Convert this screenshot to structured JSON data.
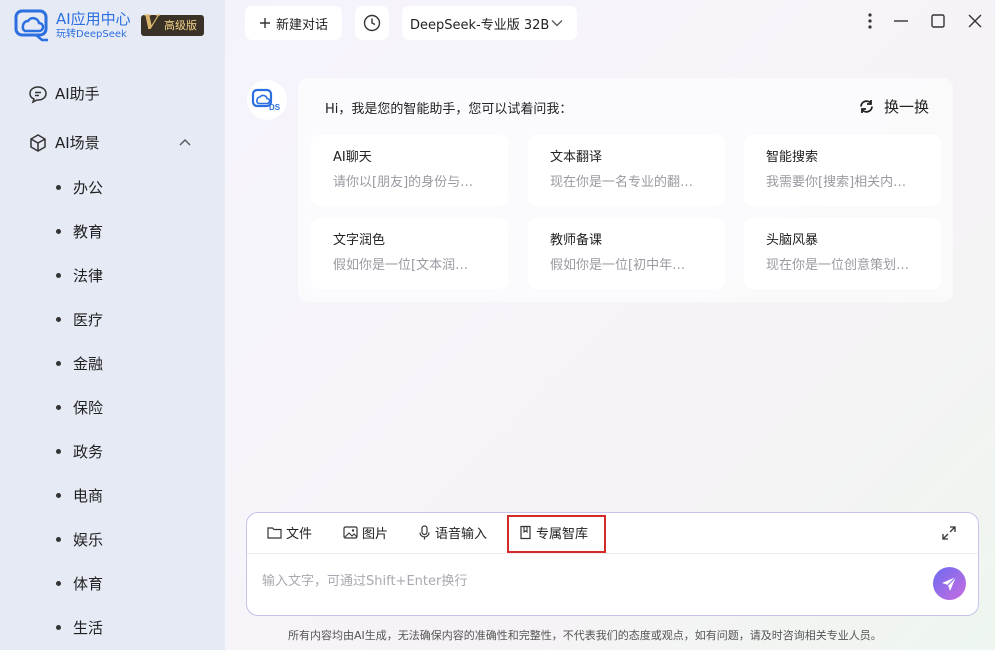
{
  "brand": {
    "title": "AI应用中心",
    "subtitle": "玩转DeepSeek",
    "badge_letter": "V",
    "badge_text": "高级版",
    "accent": "#2b6fe0"
  },
  "sidebar": {
    "items": [
      {
        "label": "AI助手",
        "icon": "chat-bubble-icon"
      },
      {
        "label": "AI场景",
        "icon": "cube-icon"
      }
    ],
    "scenes": [
      "办公",
      "教育",
      "法律",
      "医疗",
      "金融",
      "保险",
      "政务",
      "电商",
      "娱乐",
      "体育",
      "生活"
    ]
  },
  "topbar": {
    "new_chat": "新建对话",
    "model": "DeepSeek-专业版 32B"
  },
  "assistant": {
    "avatar_text": "DS",
    "greeting": "Hi，我是您的智能助手，您可以试着问我：",
    "refresh_label": "换一换",
    "cards": [
      {
        "title": "AI聊天",
        "desc": "请你以[朋友]的身份与…"
      },
      {
        "title": "文本翻译",
        "desc": "现在你是一名专业的翻…"
      },
      {
        "title": "智能搜索",
        "desc": "我需要你[搜索]相关内…"
      },
      {
        "title": "文字润色",
        "desc": "假如你是一位[文本润…"
      },
      {
        "title": "教师备课",
        "desc": "假如你是一位[初中年…"
      },
      {
        "title": "头脑风暴",
        "desc": "现在你是一位创意策划…"
      }
    ]
  },
  "composer": {
    "tools": [
      "文件",
      "图片",
      "语音输入",
      "专属智库"
    ],
    "placeholder": "输入文字，可通过Shift+Enter换行"
  },
  "footer": "所有内容均由AI生成，无法确保内容的准确性和完整性，不代表我们的态度或观点，如有问题，请及时咨询相关专业人员。"
}
